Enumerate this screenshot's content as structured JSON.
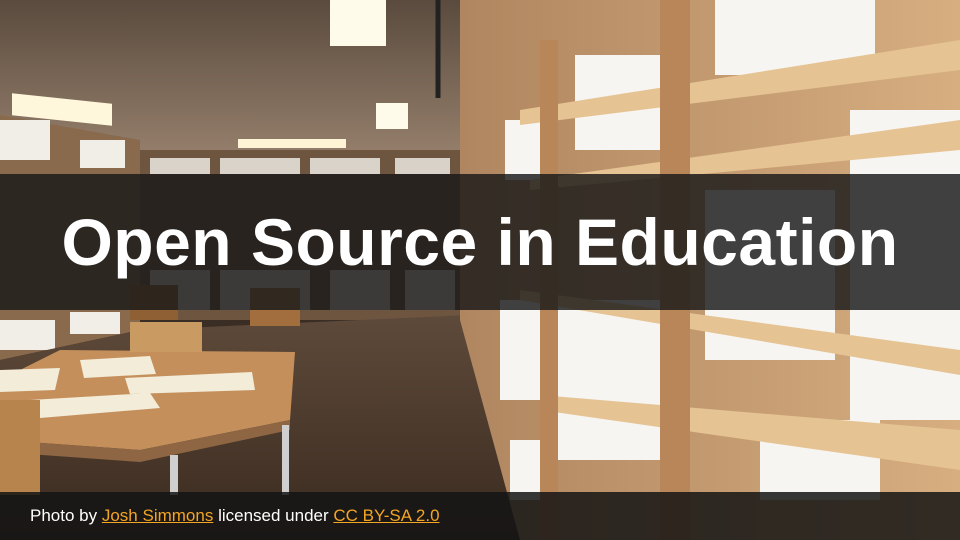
{
  "slide": {
    "title": "Open Source in Education"
  },
  "credit": {
    "prefix": "Photo by",
    "author": "Josh Simmons",
    "middle": "licensed under",
    "license": "CC BY-SA 2.0"
  },
  "colors": {
    "link": "#f3a524",
    "title_text": "#ffffff",
    "band": "#191919"
  }
}
